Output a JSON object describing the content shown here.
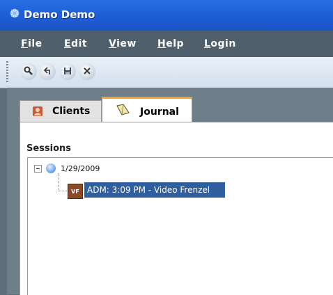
{
  "window": {
    "title": "Demo Demo"
  },
  "menu": {
    "items": [
      "File",
      "Edit",
      "View",
      "Help",
      "Login"
    ]
  },
  "toolbar": {
    "buttons": [
      "search-icon",
      "login-icon",
      "save-icon",
      "close-icon"
    ]
  },
  "tabs": [
    {
      "label": "Clients",
      "icon": "person-icon",
      "active": false
    },
    {
      "label": "Journal",
      "icon": "journal-icon",
      "active": true
    }
  ],
  "sessions": {
    "title": "Sessions",
    "date": "1/29/2009",
    "entry_badge": "VF",
    "entry_label": "ADM: 3:09 PM - Video Frenzel"
  },
  "colors": {
    "titlebar": "#1f5fd6",
    "menubar": "#4f5f6b",
    "selection": "#2f5f9f",
    "tab_accent": "#f5a623"
  }
}
